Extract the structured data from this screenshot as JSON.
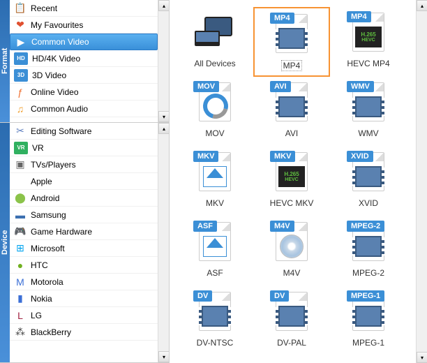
{
  "sections": {
    "format": {
      "title": "Format",
      "items": [
        {
          "label": "Recent",
          "icon": "📋",
          "color": "#f0a050"
        },
        {
          "label": "My Favourites",
          "icon": "❤",
          "color": "#e05030"
        },
        {
          "label": "Common Video",
          "icon": "▶",
          "color": "#fff",
          "selected": true
        },
        {
          "label": "HD/4K Video",
          "icon": "HD",
          "color": "#3b8fd6",
          "badge": true
        },
        {
          "label": "3D Video",
          "icon": "3D",
          "color": "#3b8fd6",
          "badge": true
        },
        {
          "label": "Online Video",
          "icon": "ƒ",
          "color": "#f07030"
        },
        {
          "label": "Common Audio",
          "icon": "♫",
          "color": "#f0a030"
        }
      ]
    },
    "device": {
      "title": "Device",
      "items": [
        {
          "label": "Editing Software",
          "icon": "✂",
          "color": "#6080c0"
        },
        {
          "label": "VR",
          "icon": "VR",
          "color": "#30b060",
          "badge": true
        },
        {
          "label": "TVs/Players",
          "icon": "▣",
          "color": "#666"
        },
        {
          "label": "Apple",
          "icon": "",
          "color": "#888"
        },
        {
          "label": "Android",
          "icon": "⬤",
          "color": "#8bc34a"
        },
        {
          "label": "Samsung",
          "icon": "▬",
          "color": "#3b6fb0"
        },
        {
          "label": "Game Hardware",
          "icon": "🎮",
          "color": "#666"
        },
        {
          "label": "Microsoft",
          "icon": "⊞",
          "color": "#00a4ef"
        },
        {
          "label": "HTC",
          "icon": "●",
          "color": "#70b020"
        },
        {
          "label": "Motorola",
          "icon": "M",
          "color": "#3b6fd6"
        },
        {
          "label": "Nokia",
          "icon": "▮",
          "color": "#3b6fd6"
        },
        {
          "label": "LG",
          "icon": "L",
          "color": "#a02040"
        },
        {
          "label": "BlackBerry",
          "icon": "⁂",
          "color": "#444"
        }
      ]
    }
  },
  "grid": [
    {
      "label": "All Devices",
      "type": "devices"
    },
    {
      "label": "MP4",
      "badge": "MP4",
      "type": "film",
      "selected": true
    },
    {
      "label": "HEVC MP4",
      "badge": "MP4",
      "type": "hevc"
    },
    {
      "label": "MOV",
      "badge": "MOV",
      "type": "qt"
    },
    {
      "label": "AVI",
      "badge": "AVI",
      "type": "film"
    },
    {
      "label": "WMV",
      "badge": "WMV",
      "type": "film"
    },
    {
      "label": "MKV",
      "badge": "MKV",
      "type": "mkv"
    },
    {
      "label": "HEVC MKV",
      "badge": "MKV",
      "type": "hevc"
    },
    {
      "label": "XVID",
      "badge": "XVID",
      "type": "film"
    },
    {
      "label": "ASF",
      "badge": "ASF",
      "type": "mkv"
    },
    {
      "label": "M4V",
      "badge": "M4V",
      "type": "disc"
    },
    {
      "label": "MPEG-2",
      "badge": "MPEG-2",
      "type": "film"
    },
    {
      "label": "DV-NTSC",
      "badge": "DV",
      "type": "film"
    },
    {
      "label": "DV-PAL",
      "badge": "DV",
      "type": "film"
    },
    {
      "label": "MPEG-1",
      "badge": "MPEG-1",
      "type": "film"
    }
  ]
}
